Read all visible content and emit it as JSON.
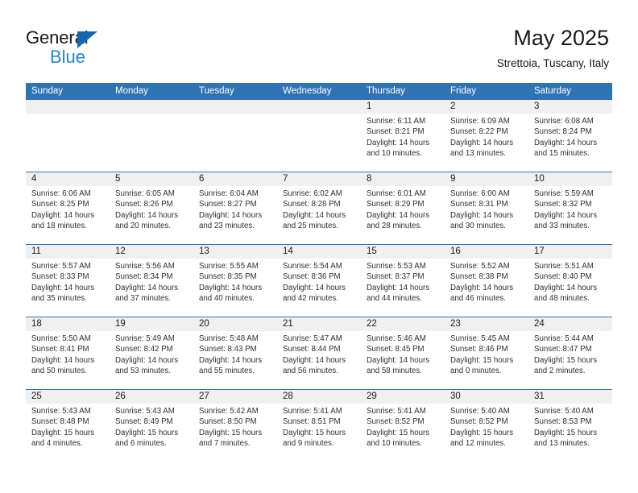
{
  "brand": {
    "name_part1": "General",
    "name_part2": "Blue",
    "logo_icon": "blue-triangle-logo",
    "accent_color": "#1566b0",
    "secondary_color": "#1f84d6"
  },
  "header": {
    "title": "May 2025",
    "subtitle": "Strettoia, Tuscany, Italy"
  },
  "theme": {
    "header_blue": "#2e74b5",
    "daynum_band": "#f0f0f0",
    "text": "#303030"
  },
  "calendar": {
    "weekday_headers": [
      "Sunday",
      "Monday",
      "Tuesday",
      "Wednesday",
      "Thursday",
      "Friday",
      "Saturday"
    ],
    "weeks": [
      [
        {
          "day": "",
          "sunrise": "",
          "sunset": "",
          "daylight_line1": "",
          "daylight_line2": "",
          "empty": true
        },
        {
          "day": "",
          "sunrise": "",
          "sunset": "",
          "daylight_line1": "",
          "daylight_line2": "",
          "empty": true
        },
        {
          "day": "",
          "sunrise": "",
          "sunset": "",
          "daylight_line1": "",
          "daylight_line2": "",
          "empty": true
        },
        {
          "day": "",
          "sunrise": "",
          "sunset": "",
          "daylight_line1": "",
          "daylight_line2": "",
          "empty": true
        },
        {
          "day": "1",
          "sunrise": "Sunrise: 6:11 AM",
          "sunset": "Sunset: 8:21 PM",
          "daylight_line1": "Daylight: 14 hours",
          "daylight_line2": "and 10 minutes.",
          "empty": false
        },
        {
          "day": "2",
          "sunrise": "Sunrise: 6:09 AM",
          "sunset": "Sunset: 8:22 PM",
          "daylight_line1": "Daylight: 14 hours",
          "daylight_line2": "and 13 minutes.",
          "empty": false
        },
        {
          "day": "3",
          "sunrise": "Sunrise: 6:08 AM",
          "sunset": "Sunset: 8:24 PM",
          "daylight_line1": "Daylight: 14 hours",
          "daylight_line2": "and 15 minutes.",
          "empty": false
        }
      ],
      [
        {
          "day": "4",
          "sunrise": "Sunrise: 6:06 AM",
          "sunset": "Sunset: 8:25 PM",
          "daylight_line1": "Daylight: 14 hours",
          "daylight_line2": "and 18 minutes.",
          "empty": false
        },
        {
          "day": "5",
          "sunrise": "Sunrise: 6:05 AM",
          "sunset": "Sunset: 8:26 PM",
          "daylight_line1": "Daylight: 14 hours",
          "daylight_line2": "and 20 minutes.",
          "empty": false
        },
        {
          "day": "6",
          "sunrise": "Sunrise: 6:04 AM",
          "sunset": "Sunset: 8:27 PM",
          "daylight_line1": "Daylight: 14 hours",
          "daylight_line2": "and 23 minutes.",
          "empty": false
        },
        {
          "day": "7",
          "sunrise": "Sunrise: 6:02 AM",
          "sunset": "Sunset: 8:28 PM",
          "daylight_line1": "Daylight: 14 hours",
          "daylight_line2": "and 25 minutes.",
          "empty": false
        },
        {
          "day": "8",
          "sunrise": "Sunrise: 6:01 AM",
          "sunset": "Sunset: 8:29 PM",
          "daylight_line1": "Daylight: 14 hours",
          "daylight_line2": "and 28 minutes.",
          "empty": false
        },
        {
          "day": "9",
          "sunrise": "Sunrise: 6:00 AM",
          "sunset": "Sunset: 8:31 PM",
          "daylight_line1": "Daylight: 14 hours",
          "daylight_line2": "and 30 minutes.",
          "empty": false
        },
        {
          "day": "10",
          "sunrise": "Sunrise: 5:59 AM",
          "sunset": "Sunset: 8:32 PM",
          "daylight_line1": "Daylight: 14 hours",
          "daylight_line2": "and 33 minutes.",
          "empty": false
        }
      ],
      [
        {
          "day": "11",
          "sunrise": "Sunrise: 5:57 AM",
          "sunset": "Sunset: 8:33 PM",
          "daylight_line1": "Daylight: 14 hours",
          "daylight_line2": "and 35 minutes.",
          "empty": false
        },
        {
          "day": "12",
          "sunrise": "Sunrise: 5:56 AM",
          "sunset": "Sunset: 8:34 PM",
          "daylight_line1": "Daylight: 14 hours",
          "daylight_line2": "and 37 minutes.",
          "empty": false
        },
        {
          "day": "13",
          "sunrise": "Sunrise: 5:55 AM",
          "sunset": "Sunset: 8:35 PM",
          "daylight_line1": "Daylight: 14 hours",
          "daylight_line2": "and 40 minutes.",
          "empty": false
        },
        {
          "day": "14",
          "sunrise": "Sunrise: 5:54 AM",
          "sunset": "Sunset: 8:36 PM",
          "daylight_line1": "Daylight: 14 hours",
          "daylight_line2": "and 42 minutes.",
          "empty": false
        },
        {
          "day": "15",
          "sunrise": "Sunrise: 5:53 AM",
          "sunset": "Sunset: 8:37 PM",
          "daylight_line1": "Daylight: 14 hours",
          "daylight_line2": "and 44 minutes.",
          "empty": false
        },
        {
          "day": "16",
          "sunrise": "Sunrise: 5:52 AM",
          "sunset": "Sunset: 8:38 PM",
          "daylight_line1": "Daylight: 14 hours",
          "daylight_line2": "and 46 minutes.",
          "empty": false
        },
        {
          "day": "17",
          "sunrise": "Sunrise: 5:51 AM",
          "sunset": "Sunset: 8:40 PM",
          "daylight_line1": "Daylight: 14 hours",
          "daylight_line2": "and 48 minutes.",
          "empty": false
        }
      ],
      [
        {
          "day": "18",
          "sunrise": "Sunrise: 5:50 AM",
          "sunset": "Sunset: 8:41 PM",
          "daylight_line1": "Daylight: 14 hours",
          "daylight_line2": "and 50 minutes.",
          "empty": false
        },
        {
          "day": "19",
          "sunrise": "Sunrise: 5:49 AM",
          "sunset": "Sunset: 8:42 PM",
          "daylight_line1": "Daylight: 14 hours",
          "daylight_line2": "and 53 minutes.",
          "empty": false
        },
        {
          "day": "20",
          "sunrise": "Sunrise: 5:48 AM",
          "sunset": "Sunset: 8:43 PM",
          "daylight_line1": "Daylight: 14 hours",
          "daylight_line2": "and 55 minutes.",
          "empty": false
        },
        {
          "day": "21",
          "sunrise": "Sunrise: 5:47 AM",
          "sunset": "Sunset: 8:44 PM",
          "daylight_line1": "Daylight: 14 hours",
          "daylight_line2": "and 56 minutes.",
          "empty": false
        },
        {
          "day": "22",
          "sunrise": "Sunrise: 5:46 AM",
          "sunset": "Sunset: 8:45 PM",
          "daylight_line1": "Daylight: 14 hours",
          "daylight_line2": "and 58 minutes.",
          "empty": false
        },
        {
          "day": "23",
          "sunrise": "Sunrise: 5:45 AM",
          "sunset": "Sunset: 8:46 PM",
          "daylight_line1": "Daylight: 15 hours",
          "daylight_line2": "and 0 minutes.",
          "empty": false
        },
        {
          "day": "24",
          "sunrise": "Sunrise: 5:44 AM",
          "sunset": "Sunset: 8:47 PM",
          "daylight_line1": "Daylight: 15 hours",
          "daylight_line2": "and 2 minutes.",
          "empty": false
        }
      ],
      [
        {
          "day": "25",
          "sunrise": "Sunrise: 5:43 AM",
          "sunset": "Sunset: 8:48 PM",
          "daylight_line1": "Daylight: 15 hours",
          "daylight_line2": "and 4 minutes.",
          "empty": false
        },
        {
          "day": "26",
          "sunrise": "Sunrise: 5:43 AM",
          "sunset": "Sunset: 8:49 PM",
          "daylight_line1": "Daylight: 15 hours",
          "daylight_line2": "and 6 minutes.",
          "empty": false
        },
        {
          "day": "27",
          "sunrise": "Sunrise: 5:42 AM",
          "sunset": "Sunset: 8:50 PM",
          "daylight_line1": "Daylight: 15 hours",
          "daylight_line2": "and 7 minutes.",
          "empty": false
        },
        {
          "day": "28",
          "sunrise": "Sunrise: 5:41 AM",
          "sunset": "Sunset: 8:51 PM",
          "daylight_line1": "Daylight: 15 hours",
          "daylight_line2": "and 9 minutes.",
          "empty": false
        },
        {
          "day": "29",
          "sunrise": "Sunrise: 5:41 AM",
          "sunset": "Sunset: 8:52 PM",
          "daylight_line1": "Daylight: 15 hours",
          "daylight_line2": "and 10 minutes.",
          "empty": false
        },
        {
          "day": "30",
          "sunrise": "Sunrise: 5:40 AM",
          "sunset": "Sunset: 8:52 PM",
          "daylight_line1": "Daylight: 15 hours",
          "daylight_line2": "and 12 minutes.",
          "empty": false
        },
        {
          "day": "31",
          "sunrise": "Sunrise: 5:40 AM",
          "sunset": "Sunset: 8:53 PM",
          "daylight_line1": "Daylight: 15 hours",
          "daylight_line2": "and 13 minutes.",
          "empty": false
        }
      ]
    ]
  }
}
